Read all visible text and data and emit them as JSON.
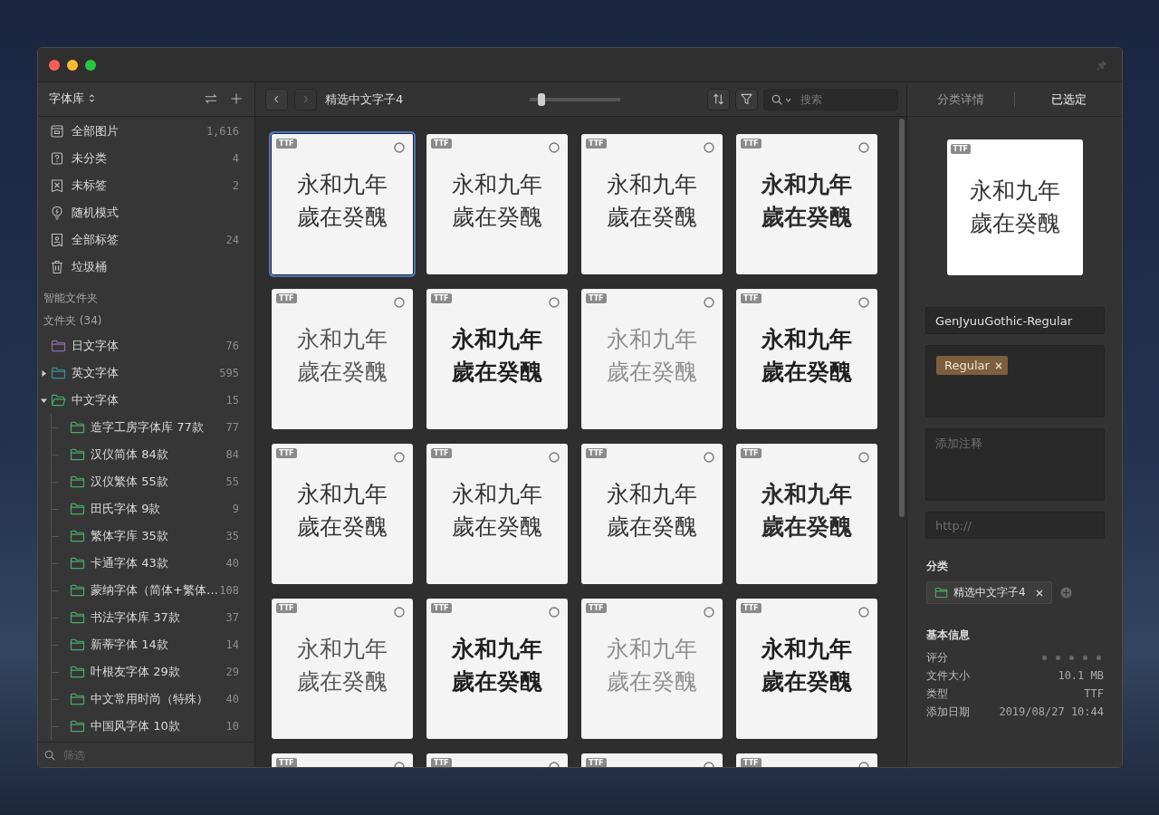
{
  "sidebar": {
    "library": {
      "label": "字体库"
    },
    "items": [
      {
        "label": "全部图片",
        "count": "1,616"
      },
      {
        "label": "未分类",
        "count": "4"
      },
      {
        "label": "未标签",
        "count": "2"
      },
      {
        "label": "随机模式"
      },
      {
        "label": "全部标签",
        "count": "24"
      },
      {
        "label": "垃圾桶"
      }
    ],
    "smart_folders_heading": "智能文件夹",
    "folders_heading": "文件夹 (34)",
    "folders": [
      {
        "label": "日文字体",
        "count": "76",
        "color": "#8c6cae"
      },
      {
        "label": "英文字体",
        "count": "595",
        "color": "#3d8e93",
        "expanded": false
      },
      {
        "label": "中文字体",
        "count": "15",
        "color": "#4caa68",
        "expanded": true,
        "children": [
          {
            "label": "造字工房字体库 77款",
            "count": "77",
            "color": "#4caa68"
          },
          {
            "label": "汉仪简体 84款",
            "count": "84",
            "color": "#4caa68"
          },
          {
            "label": "汉仪繁体 55款",
            "count": "55",
            "color": "#4caa68"
          },
          {
            "label": "田氏字体 9款",
            "count": "9",
            "color": "#4caa68"
          },
          {
            "label": "繁体字库 35款",
            "count": "35",
            "color": "#4caa68"
          },
          {
            "label": "卡通字体 43款",
            "count": "40",
            "color": "#4caa68"
          },
          {
            "label": "蒙纳字体（简体+繁体…",
            "count": "108",
            "color": "#4caa68"
          },
          {
            "label": "书法字体库 37款",
            "count": "37",
            "color": "#4caa68"
          },
          {
            "label": "新蒂字体 14款",
            "count": "14",
            "color": "#4caa68"
          },
          {
            "label": "叶根友字体 29款",
            "count": "29",
            "color": "#4caa68"
          },
          {
            "label": "中文常用时尚（特殊）",
            "count": "40",
            "color": "#4caa68"
          },
          {
            "label": "中国风字体 10款",
            "count": "10",
            "color": "#4caa68"
          }
        ]
      }
    ],
    "filter": {
      "placeholder": "筛选"
    }
  },
  "toolbar": {
    "back": {
      "disabled": false
    },
    "forward": {
      "disabled": true
    },
    "title": "精选中文字子4",
    "zoom": {
      "level": 0.1
    },
    "search": {
      "placeholder": "搜索"
    }
  },
  "grid": {
    "cards": [
      {
        "kind": "regular",
        "badge": "TTF",
        "lines": [
          "永和九年",
          "歲在癸醜"
        ],
        "selected": true,
        "checked": false
      },
      {
        "kind": "regular",
        "badge": "TTF",
        "lines": [
          "永和九年",
          "歲在癸醜"
        ],
        "selected": false,
        "checked": false
      },
      {
        "kind": "regular",
        "badge": "TTF",
        "lines": [
          "永和九年",
          "歲在癸醜"
        ],
        "selected": false,
        "checked": false
      },
      {
        "kind": "medium",
        "badge": "TTF",
        "lines": [
          "永和九年",
          "歲在癸醜"
        ],
        "selected": false,
        "checked": false
      },
      {
        "kind": "light",
        "badge": "TTF",
        "lines": [
          "永和九年",
          "歲在癸醜"
        ],
        "selected": false,
        "checked": false
      },
      {
        "kind": "heavy",
        "badge": "TTF",
        "lines": [
          "永和九年",
          "歲在癸醜"
        ],
        "selected": false,
        "checked": false
      },
      {
        "kind": "thin",
        "badge": "TTF",
        "lines": [
          "永和九年",
          "歲在癸醜"
        ],
        "selected": false,
        "checked": false
      },
      {
        "kind": "heavy",
        "badge": "TTF",
        "lines": [
          "永和九年",
          "歲在癸醜"
        ],
        "selected": false,
        "checked": false
      },
      {
        "kind": "regular",
        "badge": "TTF",
        "lines": [
          "永和九年",
          "歲在癸醜"
        ],
        "selected": false,
        "checked": false
      },
      {
        "kind": "regular",
        "badge": "TTF",
        "lines": [
          "永和九年",
          "歲在癸醜"
        ],
        "selected": false,
        "checked": false
      },
      {
        "kind": "regular",
        "badge": "TTF",
        "lines": [
          "永和九年",
          "歲在癸醜"
        ],
        "selected": false,
        "checked": false
      },
      {
        "kind": "medium",
        "badge": "TTF",
        "lines": [
          "永和九年",
          "歲在癸醜"
        ],
        "selected": false,
        "checked": false
      },
      {
        "kind": "light",
        "badge": "TTF",
        "lines": [
          "永和九年",
          "歲在癸醜"
        ],
        "selected": false,
        "checked": false
      },
      {
        "kind": "heavy",
        "badge": "TTF",
        "lines": [
          "永和九年",
          "歲在癸醜"
        ],
        "selected": false,
        "checked": false
      },
      {
        "kind": "thin",
        "badge": "TTF",
        "lines": [
          "永和九年",
          "歲在癸醜"
        ],
        "selected": false,
        "checked": false
      },
      {
        "kind": "heavy",
        "badge": "TTF",
        "lines": [
          "永和九年",
          "歲在癸醜"
        ],
        "selected": false,
        "checked": false
      },
      {
        "badge": "TTF",
        "selected": false,
        "checked": false
      },
      {
        "badge": "TTF",
        "selected": false,
        "checked": false
      },
      {
        "badge": "TTF",
        "selected": false,
        "checked": false
      },
      {
        "badge": "TTF",
        "selected": false,
        "checked": false
      }
    ]
  },
  "inspector": {
    "tabs": [
      {
        "label": "分类详情",
        "selected": false
      },
      {
        "label": "已选定",
        "selected": true
      }
    ],
    "preview": {
      "badge": "TTF",
      "lines": [
        "永和九年",
        "歲在癸醜"
      ]
    },
    "name": {
      "value": "GenJyuuGothic-Regular"
    },
    "tags": [
      {
        "label": "Regular"
      }
    ],
    "note": {
      "placeholder": "添加注释"
    },
    "url": {
      "placeholder": "http://"
    },
    "category": {
      "heading": "分类",
      "folders": [
        {
          "label": "精选中文字子4"
        }
      ]
    },
    "info": {
      "heading": "基本信息",
      "rows": [
        {
          "kind": "rating",
          "label": "评分",
          "stars": 0
        },
        {
          "kind": "text",
          "label": "文件大小",
          "value": "10.1 MB"
        },
        {
          "kind": "text",
          "label": "类型",
          "value": "TTF"
        },
        {
          "kind": "text",
          "label": "添加日期",
          "value": "2019/08/27 10:44"
        }
      ]
    }
  }
}
